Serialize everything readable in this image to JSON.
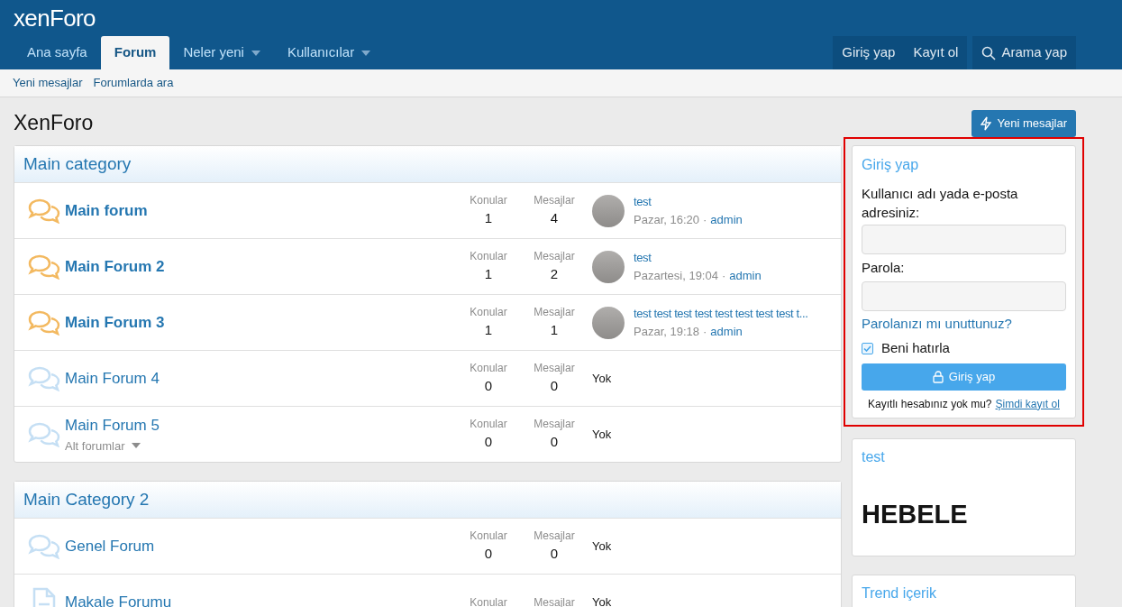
{
  "logo": {
    "text": "xenForo"
  },
  "nav_tabs": [
    {
      "label": "Ana sayfa",
      "selected": false,
      "dropdown": false
    },
    {
      "label": "Forum",
      "selected": true,
      "dropdown": false
    },
    {
      "label": "Neler yeni",
      "selected": false,
      "dropdown": true
    },
    {
      "label": "Kullanıcılar",
      "selected": false,
      "dropdown": true
    }
  ],
  "account_links": [
    "Giriş yap",
    "Kayıt ol"
  ],
  "search_button": "Arama yap",
  "sub_nav": [
    "Yeni mesajlar",
    "Forumlarda ara"
  ],
  "page_title": "XenForo",
  "new_posts_button": "Yeni mesajlar",
  "categories": [
    {
      "title": "Main category",
      "forums": [
        {
          "kind": "forum",
          "title": "Main forum",
          "unread": true,
          "threads_label": "Konular",
          "threads": "1",
          "messages_label": "Mesajlar",
          "messages": "4",
          "last_post": {
            "title": "test",
            "date": "Pazar, 16:20",
            "separator": "·",
            "user": "admin"
          }
        },
        {
          "kind": "forum",
          "title": "Main Forum 2",
          "unread": true,
          "threads_label": "Konular",
          "threads": "1",
          "messages_label": "Mesajlar",
          "messages": "2",
          "last_post": {
            "title": "test",
            "date": "Pazartesi, 19:04",
            "separator": "·",
            "user": "admin"
          }
        },
        {
          "kind": "forum",
          "title": "Main Forum 3",
          "unread": true,
          "threads_label": "Konular",
          "threads": "1",
          "messages_label": "Mesajlar",
          "messages": "1",
          "last_post": {
            "title": "test test test test test test test test t...",
            "date": "Pazar, 19:18",
            "separator": "·",
            "user": "admin"
          }
        },
        {
          "kind": "forum",
          "title": "Main Forum 4",
          "unread": false,
          "threads_label": "Konular",
          "threads": "0",
          "messages_label": "Mesajlar",
          "messages": "0",
          "last_post_none": "Yok"
        },
        {
          "kind": "forum",
          "title": "Main Forum 5",
          "unread": false,
          "subforums": "Alt forumlar",
          "threads_label": "Konular",
          "threads": "0",
          "messages_label": "Mesajlar",
          "messages": "0",
          "last_post_none": "Yok"
        }
      ]
    },
    {
      "title": "Main Category 2",
      "forums": [
        {
          "kind": "forum",
          "title": "Genel Forum",
          "unread": false,
          "threads_label": "Konular",
          "threads": "0",
          "messages_label": "Mesajlar",
          "messages": "0",
          "last_post_none": "Yok"
        },
        {
          "kind": "article",
          "title": "Makale Forumu",
          "unread": false,
          "threads_label": "Konular",
          "messages_label": "Mesajlar",
          "last_post_none": "Yok"
        }
      ]
    }
  ],
  "login_widget": {
    "title": "Giriş yap",
    "highlighted": true,
    "username_label": "Kullanıcı adı yada e-posta adresiniz:",
    "password_label": "Parola:",
    "forgot_link": "Parolanızı mı unuttunuz?",
    "remember": {
      "label": "Beni hatırla",
      "checked": true
    },
    "submit": "Giriş yap",
    "register_prompt": "Kayıtlı hesabınız yok mu?",
    "register_link": "Şimdi kayıt ol"
  },
  "test_widget": {
    "title": "test",
    "body": "HEBELE"
  },
  "trend_widget": {
    "title": "Trend içerik"
  }
}
